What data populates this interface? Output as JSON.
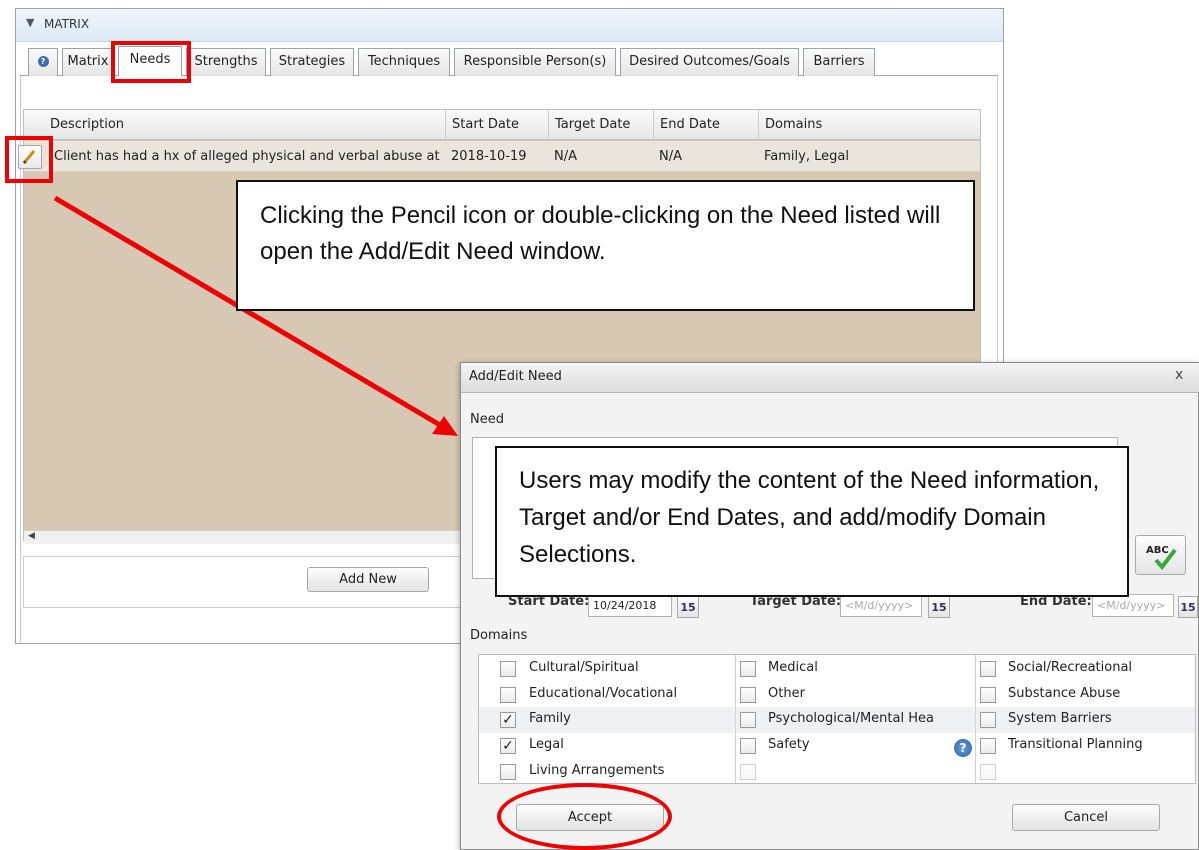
{
  "section": {
    "title": "MATRIX",
    "chevron_icon": "chevron-down-icon"
  },
  "tabs": [
    {
      "label": "",
      "icon": "help-icon"
    },
    {
      "label": "Matrix"
    },
    {
      "label": "Needs",
      "active": true
    },
    {
      "label": "Strengths"
    },
    {
      "label": "Strategies"
    },
    {
      "label": "Techniques"
    },
    {
      "label": "Responsible Person(s)"
    },
    {
      "label": "Desired Outcomes/Goals"
    },
    {
      "label": "Barriers"
    }
  ],
  "grid": {
    "columns": [
      "Description",
      "Start Date",
      "Target Date",
      "End Date",
      "Domains"
    ],
    "rows": [
      [
        "Client has had a hx of alleged physical and verbal abuse at",
        "2018-10-19",
        "N/A",
        "N/A",
        "Family, Legal"
      ]
    ],
    "add_new_label": "Add New"
  },
  "callouts": {
    "pencil": "Clicking the Pencil icon or double-clicking on the Need listed will open the Add/Edit Need window.",
    "dialog": "Users may modify the content of the Need information, Target and/or End Dates, and add/modify Domain Selections."
  },
  "dialog": {
    "title": "Add/Edit Need",
    "close_label": "x",
    "need_label": "Need",
    "start_date_label": "Start Date:",
    "start_date_value": "10/24/2018",
    "target_date_label": "Target Date:",
    "target_date_placeholder": "<M/d/yyyy>",
    "end_date_label": "End Date:",
    "end_date_placeholder": "<M/d/yyyy>",
    "calendar_label": "15",
    "domains_label": "Domains",
    "domains": [
      [
        "Cultural/Spiritual",
        "Medical",
        "Social/Recreational"
      ],
      [
        "Educational/Vocational",
        "Other",
        "Substance Abuse"
      ],
      [
        "Family",
        "Psychological/Mental Hea",
        "System Barriers"
      ],
      [
        "Legal",
        "Safety",
        "Transitional Planning"
      ],
      [
        "Living Arrangements",
        "",
        ""
      ]
    ],
    "checked": [
      "Family",
      "Legal"
    ],
    "accept_label": "Accept",
    "cancel_label": "Cancel",
    "spellcheck_label": "ABC"
  },
  "colors": {
    "highlight": "#ee0000",
    "grid_bg": "#d7c8b3",
    "header_bg": "#dde9f4"
  }
}
